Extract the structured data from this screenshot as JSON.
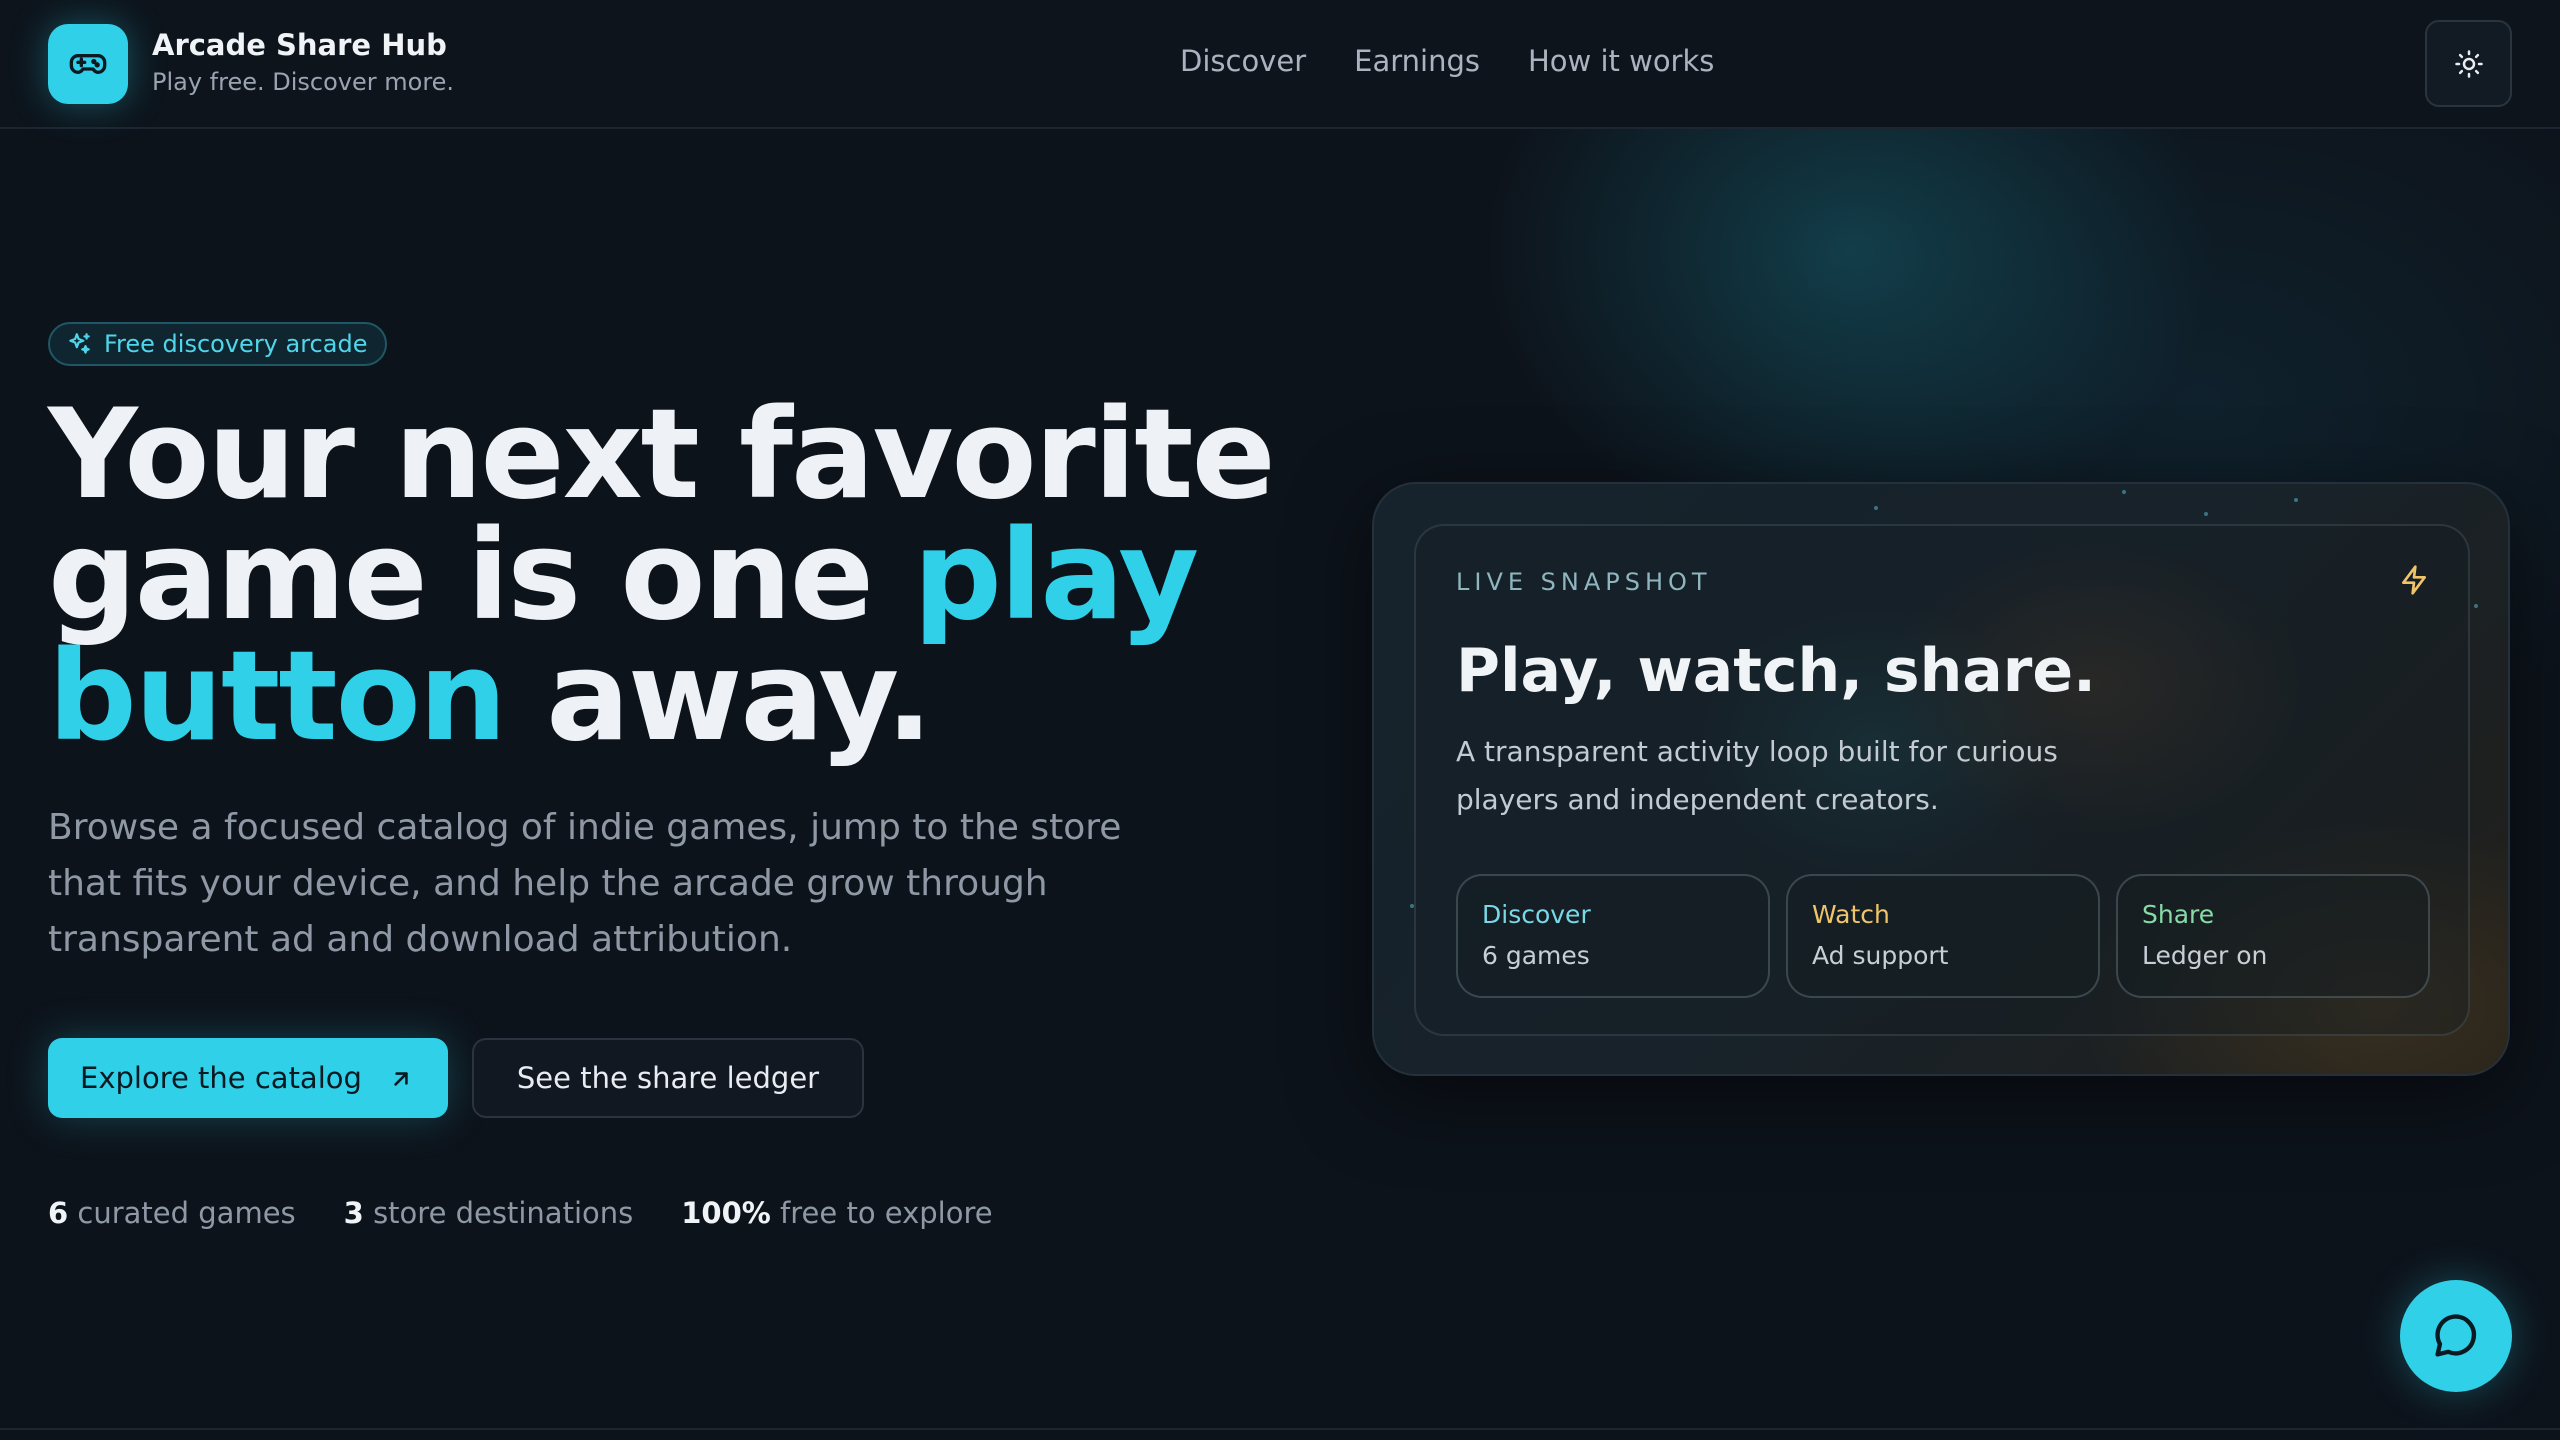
{
  "brand": {
    "title": "Arcade Share Hub",
    "tagline": "Play free. Discover more."
  },
  "nav": {
    "items": [
      "Discover",
      "Earnings",
      "How it works"
    ]
  },
  "hero": {
    "badge": "Free discovery arcade",
    "headline_1": "Your next favorite game is one ",
    "headline_accent": "play button",
    "headline_2": " away.",
    "lede": "Browse a focused catalog of indie games, jump to the store that fits your device, and help the arcade grow through transparent ad and download attribution.",
    "primary_cta": "Explore the catalog",
    "secondary_cta": "See the share ledger",
    "stats": [
      {
        "value": "6",
        "label": "curated games"
      },
      {
        "value": "3",
        "label": "store destinations"
      },
      {
        "value": "100%",
        "label": "free to explore"
      }
    ]
  },
  "snapshot": {
    "label": "LIVE SNAPSHOT",
    "title": "Play, watch, share.",
    "description": "A transparent activity loop built for curious players and independent creators.",
    "chips": [
      {
        "key": "Discover",
        "value": "6 games"
      },
      {
        "key": "Watch",
        "value": "Ad support"
      },
      {
        "key": "Share",
        "value": "Ledger on"
      }
    ]
  },
  "colors": {
    "accent": "#2fd0e8",
    "background": "#0d131b",
    "watch": "#f0c46a",
    "share": "#86dba7"
  },
  "icons": {
    "logo": "gamepad-icon",
    "theme": "sun-icon",
    "badge": "sparkles-icon",
    "cta": "arrow-up-right-icon",
    "snapshot": "bolt-icon",
    "chat": "chat-bubble-icon"
  }
}
